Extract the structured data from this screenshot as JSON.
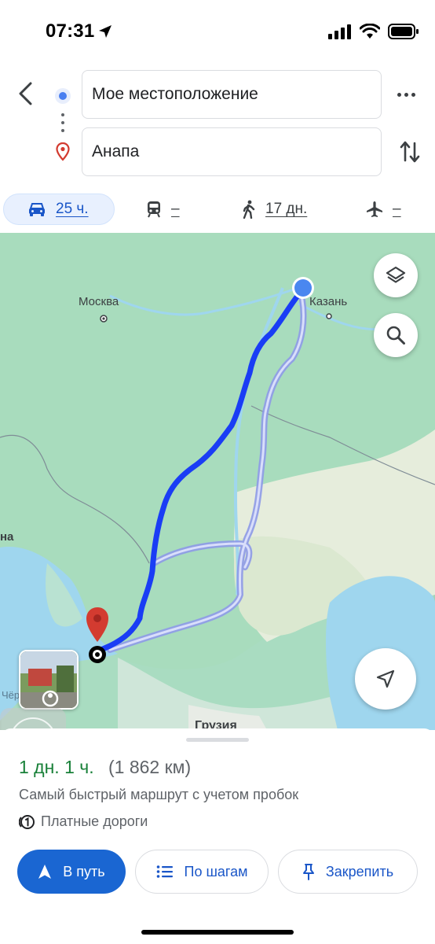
{
  "status_bar": {
    "time": "07:31"
  },
  "route_inputs": {
    "origin": "Мое местоположение",
    "destination": "Анапа"
  },
  "travel_modes": [
    {
      "mode": "car",
      "icon": "car-icon",
      "label": "25 ч.",
      "selected": true
    },
    {
      "mode": "transit",
      "icon": "train-icon",
      "label": "–",
      "selected": false
    },
    {
      "mode": "walk",
      "icon": "walk-icon",
      "label": "17 дн.",
      "selected": false
    },
    {
      "mode": "flight",
      "icon": "plane-icon",
      "label": "–",
      "selected": false
    }
  ],
  "map": {
    "labels": {
      "moscow": "Москва",
      "kazan": "Казань",
      "georgia": "Грузия",
      "west_cut": "на",
      "black_sea_cut": "Чёр"
    },
    "colors": {
      "route_primary": "#1a3df5",
      "route_alt": "#9aa6f2",
      "origin": "#4a87f0",
      "destination_pin": "#d33b30"
    }
  },
  "summary": {
    "duration": "1 дн. 1 ч.",
    "distance": "(1 862 км)",
    "description": "Самый быстрый маршрут с учетом пробок",
    "toll": "Платные дороги"
  },
  "actions": {
    "start": "В путь",
    "steps": "По шагам",
    "pin": "Закрепить"
  }
}
